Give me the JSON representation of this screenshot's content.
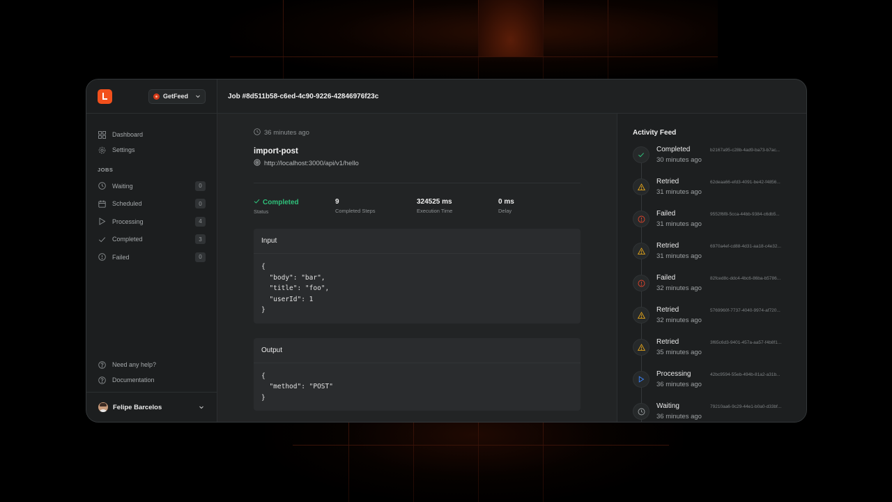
{
  "app": {
    "org_name": "GetFeed",
    "job_title": "Job #8d511b58-c6ed-4c90-9226-42846976f23c"
  },
  "sidebar": {
    "nav": [
      {
        "label": "Dashboard",
        "icon": "grid-icon"
      },
      {
        "label": "Settings",
        "icon": "gear-icon"
      }
    ],
    "jobs_section": "JOBS",
    "jobs": [
      {
        "label": "Waiting",
        "count": "0",
        "icon": "clock-icon"
      },
      {
        "label": "Scheduled",
        "count": "0",
        "icon": "calendar-icon"
      },
      {
        "label": "Processing",
        "count": "4",
        "icon": "play-icon"
      },
      {
        "label": "Completed",
        "count": "3",
        "icon": "check-icon"
      },
      {
        "label": "Failed",
        "count": "0",
        "icon": "alert-circle-icon"
      }
    ],
    "help": [
      {
        "label": "Need any help?",
        "icon": "help-circle-icon"
      },
      {
        "label": "Documentation",
        "icon": "help-circle-icon"
      }
    ],
    "user_name": "Felipe Barcelos"
  },
  "job": {
    "time_ago": "36 minutes ago",
    "name": "import-post",
    "url": "http://localhost:3000/api/v1/hello",
    "stats": [
      {
        "value": "Completed",
        "label": "Status"
      },
      {
        "value": "9",
        "label": "Completed Steps"
      },
      {
        "value": "324525 ms",
        "label": "Execution Time"
      },
      {
        "value": "0 ms",
        "label": "Delay"
      }
    ],
    "input_title": "Input",
    "input_body": "{\n  \"body\": \"bar\",\n  \"title\": \"foo\",\n  \"userId\": 1\n}",
    "output_title": "Output",
    "output_body": "{\n  \"method\": \"POST\"\n}"
  },
  "activity": {
    "title": "Activity Feed",
    "items": [
      {
        "status": "Completed",
        "id": "b2167a95-c28b-4ad9-ba73-b7ac...",
        "time": "30 minutes ago",
        "icon": "check-icon",
        "color": "#2fc07a"
      },
      {
        "status": "Retried",
        "id": "62deaa66-efd3-4091-be42-f4856...",
        "time": "31 minutes ago",
        "icon": "warning-icon",
        "color": "#e0a21b"
      },
      {
        "status": "Failed",
        "id": "9552f6f8-5cca-44bb-9384-c6db5...",
        "time": "31 minutes ago",
        "icon": "alert-circle-icon",
        "color": "#e0442c"
      },
      {
        "status": "Retried",
        "id": "6970a4ef-cd88-4d31-aa18-c4e32...",
        "time": "31 minutes ago",
        "icon": "warning-icon",
        "color": "#e0a21b"
      },
      {
        "status": "Failed",
        "id": "82fced8c-ddc4-4bc6-86ba-b5786...",
        "time": "32 minutes ago",
        "icon": "alert-circle-icon",
        "color": "#e0442c"
      },
      {
        "status": "Retried",
        "id": "5769960f-7737-4040-9974-af720...",
        "time": "32 minutes ago",
        "icon": "warning-icon",
        "color": "#e0a21b"
      },
      {
        "status": "Retried",
        "id": "3f65c6d3-9401-457a-aa57-f4b8f1...",
        "time": "35 minutes ago",
        "icon": "warning-icon",
        "color": "#e0a21b"
      },
      {
        "status": "Processing",
        "id": "42bc9594-55eb-494b-81a2-a31b...",
        "time": "36 minutes ago",
        "icon": "play-icon",
        "color": "#3b82f6"
      },
      {
        "status": "Waiting",
        "id": "79210aa6-9c29-44e1-b0a0-d33bf...",
        "time": "36 minutes ago",
        "icon": "clock-icon",
        "color": "#9da1a3"
      }
    ]
  },
  "colors": {
    "accent": "#f2501c",
    "success": "#2fc07a",
    "warning": "#e0a21b",
    "danger": "#e0442c",
    "info": "#3b82f6"
  }
}
